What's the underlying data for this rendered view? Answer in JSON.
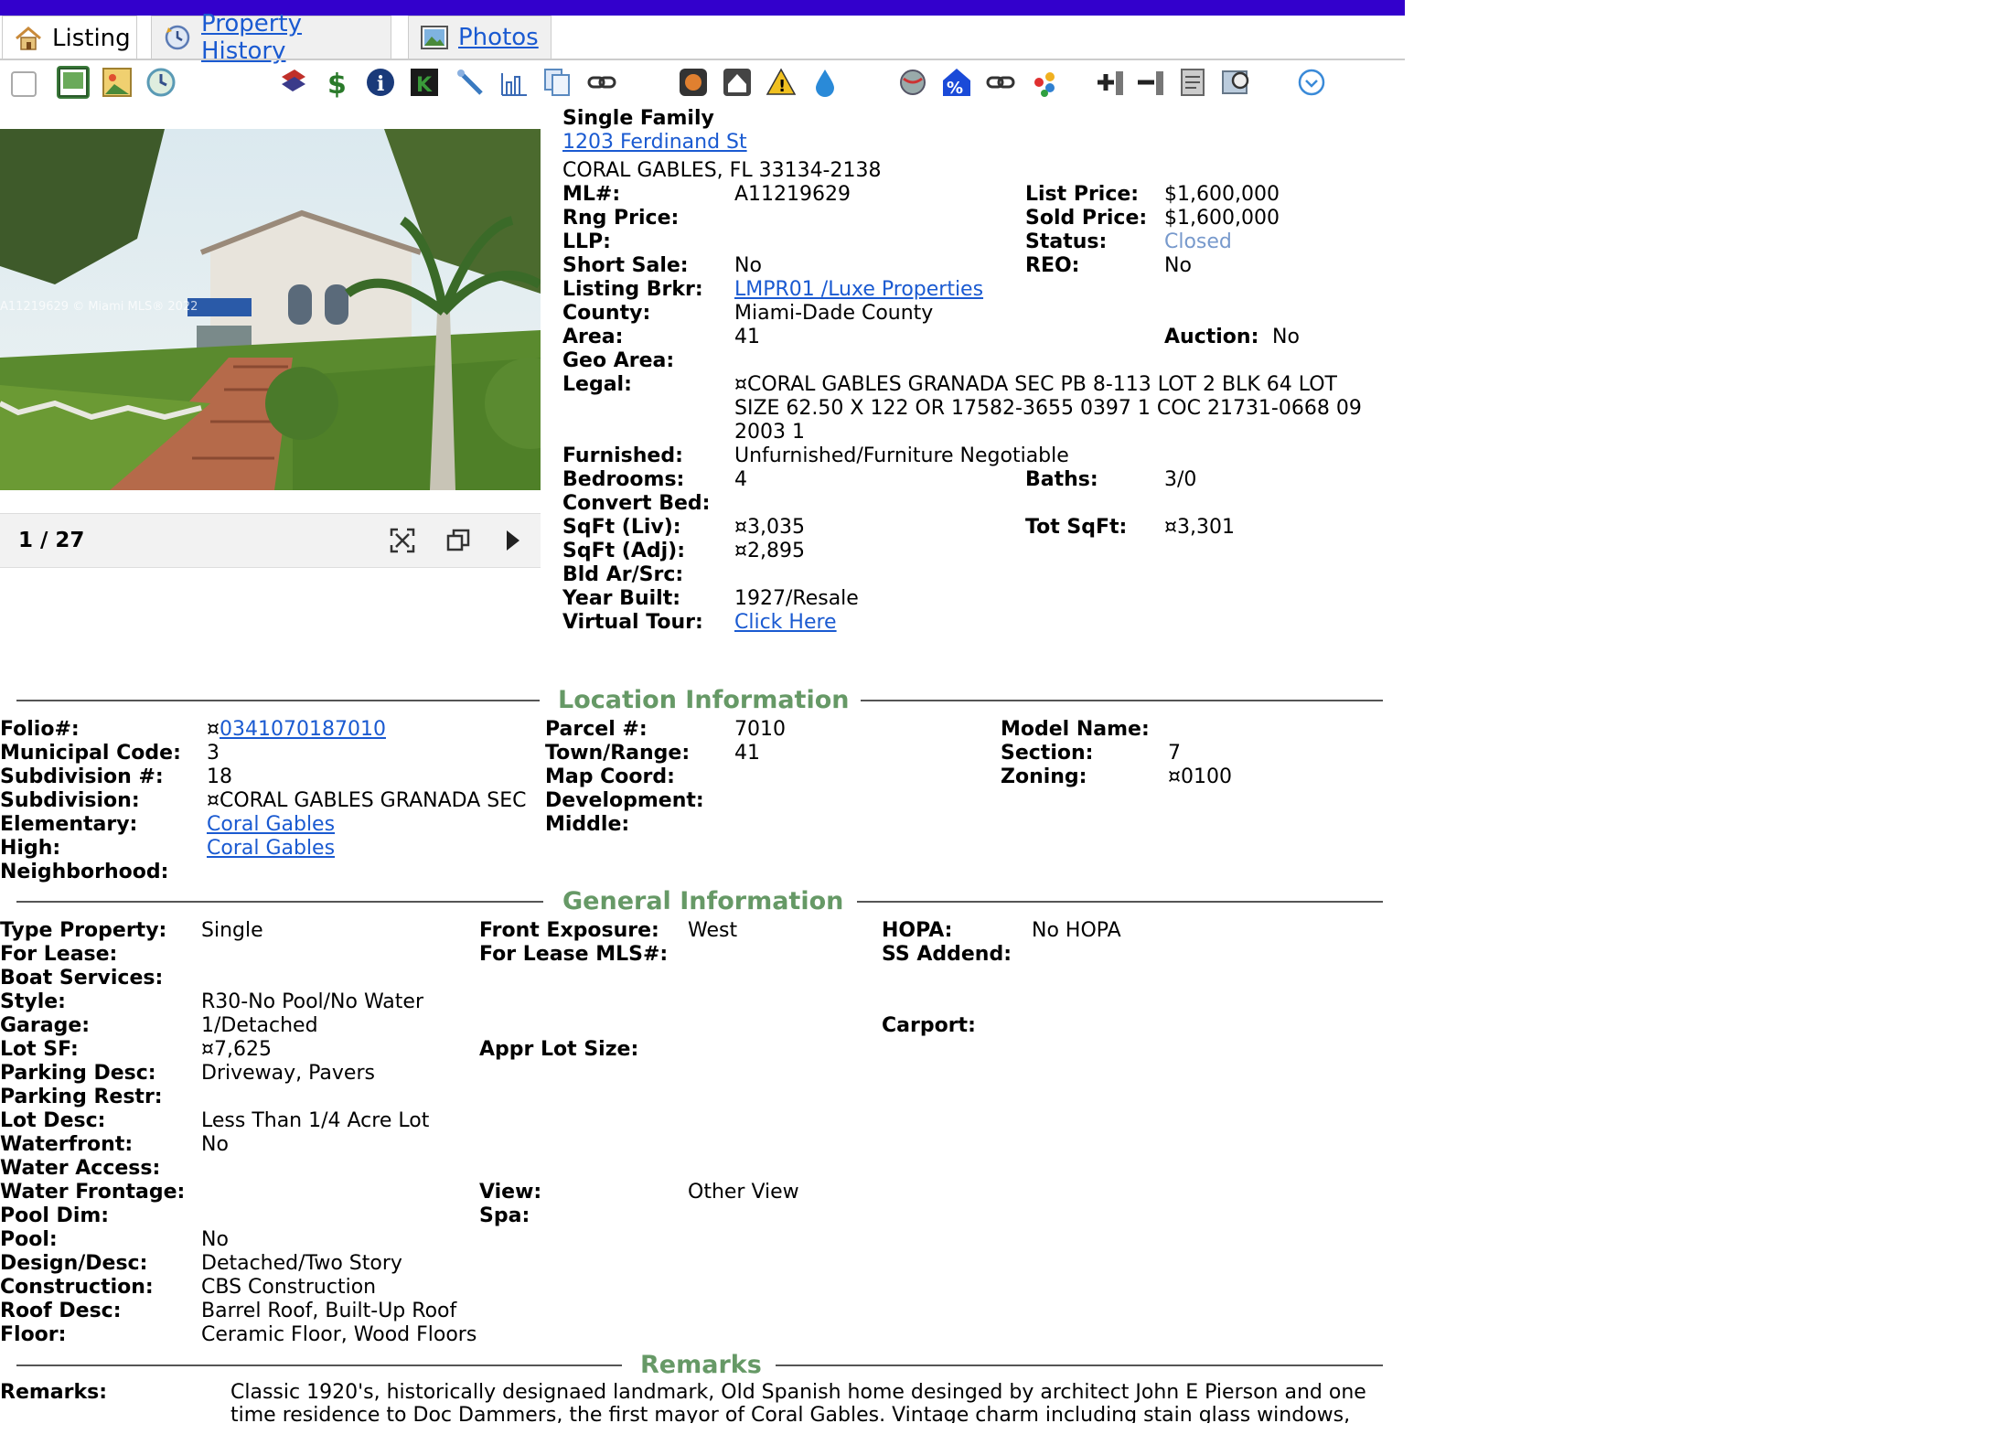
{
  "colors": {
    "topbar": "#3300cc",
    "link": "#1a5ad1",
    "section": "#669966",
    "status": "#7799cc"
  },
  "tabs": [
    {
      "label": "Listing",
      "icon": "house-icon"
    },
    {
      "label": "Property History",
      "icon": "history-clock-icon"
    },
    {
      "label": "Photos",
      "icon": "photo-icon"
    }
  ],
  "photo": {
    "counter": "1 / 27",
    "watermark": "A11219629 © Miami MLS® 2022"
  },
  "listing": {
    "type": "Single Family",
    "address": "1203 Ferdinand St",
    "city": "CORAL GABLES, FL 33134-2138",
    "labels": {
      "ml": "ML#:",
      "rng": "Rng Price:",
      "llp": "LLP:",
      "short": "Short Sale:",
      "brkr": "Listing Brkr:",
      "county": "County:",
      "area": "Area:",
      "geo": "Geo Area:",
      "legal": "Legal:",
      "furnished": "Furnished:",
      "bedrooms": "Bedrooms:",
      "convert": "Convert Bed:",
      "sqftliv": "SqFt (Liv):",
      "sqftadj": "SqFt (Adj):",
      "bld": "Bld Ar/Src:",
      "year": "Year Built:",
      "tour": "Virtual Tour:",
      "listprice": "List Price:",
      "soldprice": "Sold Price:",
      "status": "Status:",
      "reo": "REO:",
      "auction": "Auction:",
      "baths": "Baths:",
      "totsqft": "Tot SqFt:"
    },
    "values": {
      "ml": "A11219629",
      "short": "No",
      "brkr": "LMPR01 /Luxe Properties",
      "county": "Miami-Dade County",
      "area": "41",
      "legal1": "¤CORAL GABLES GRANADA SEC PB 8-113 LOT 2 BLK 64 LOT",
      "legal2": "SIZE 62.50 X 122 OR 17582-3655 0397 1 COC 21731-0668 09",
      "legal3": "2003 1",
      "furnished": "Unfurnished/Furniture Negotiable",
      "bedrooms": "4",
      "sqftliv": "¤3,035",
      "sqftadj": "¤2,895",
      "year": "1927/Resale",
      "tour": "Click Here",
      "listprice": "$1,600,000",
      "soldprice": "$1,600,000",
      "status": "Closed",
      "reo": "No",
      "auction": "No",
      "baths": "3/0",
      "totsqft": "¤3,301"
    }
  },
  "location": {
    "title": "Location Information",
    "labels": {
      "folio": "Folio#:",
      "municipal": "Municipal Code:",
      "subdivnum": "Subdivision #:",
      "subdiv": "Subdivision:",
      "elementary": "Elementary:",
      "high": "High:",
      "neighborhood": "Neighborhood:",
      "parcel": "Parcel #:",
      "town": "Town/Range:",
      "mapcoord": "Map Coord:",
      "development": "Development:",
      "middle": "Middle:",
      "model": "Model Name:",
      "section": "Section:",
      "zoning": "Zoning:"
    },
    "values": {
      "folio_prefix": "¤",
      "folio": "0341070187010",
      "municipal": "3",
      "subdivnum": "18",
      "subdiv": "¤CORAL GABLES GRANADA SEC",
      "elementary": "Coral Gables",
      "high": "Coral Gables",
      "parcel": "7010",
      "town": "41",
      "section": "7",
      "zoning": "¤0100"
    }
  },
  "general": {
    "title": "General Information",
    "labels": {
      "type": "Type Property:",
      "lease": "For Lease:",
      "boat": "Boat Services:",
      "style": "Style:",
      "garage": "Garage:",
      "lotsf": "Lot SF:",
      "parkdesc": "Parking Desc:",
      "parkrestr": "Parking Restr:",
      "lotdesc": "Lot Desc:",
      "waterfront": "Waterfront:",
      "wateraccess": "Water Access:",
      "waterfrontage": "Water Frontage:",
      "pooldim": "Pool Dim:",
      "pool": "Pool:",
      "design": "Design/Desc:",
      "construction": "Construction:",
      "roof": "Roof Desc:",
      "floor": "Floor:",
      "front": "Front Exposure:",
      "leasemls": "For Lease MLS#:",
      "apprlot": "Appr Lot Size:",
      "view": "View:",
      "spa": "Spa:",
      "hopa": "HOPA:",
      "ssaddend": "SS Addend:",
      "carport": "Carport:"
    },
    "values": {
      "type": "Single",
      "style": "R30-No Pool/No Water",
      "garage": "1/Detached",
      "lotsf": "¤7,625",
      "parkdesc": "Driveway, Pavers",
      "lotdesc": "Less Than 1/4 Acre Lot",
      "waterfront": "No",
      "pool": "No",
      "design": "Detached/Two Story",
      "construction": "CBS Construction",
      "roof": "Barrel Roof, Built-Up Roof",
      "floor": "Ceramic Floor, Wood Floors",
      "front": "West",
      "view": "Other View",
      "hopa": "No HOPA"
    }
  },
  "remarks": {
    "title": "Remarks",
    "label": "Remarks:",
    "line1": "Classic 1920's, historically designaed landmark, Old Spanish home desinged by architect John E Pierson and one",
    "line2": "time residence to Doc Dammers, the first mayor of Coral Gables. Vintage charm including stain glass windows,"
  }
}
